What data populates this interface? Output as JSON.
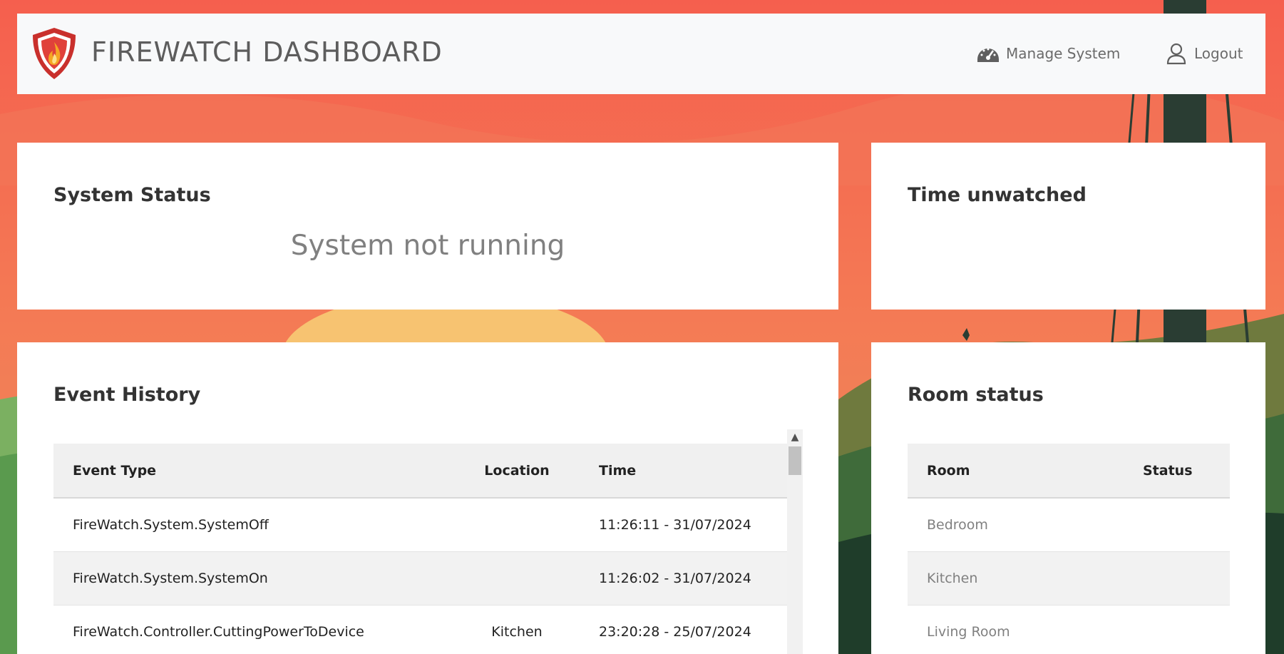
{
  "header": {
    "title": "FIREWATCH DASHBOARD",
    "logo_icon": "firewatch-shield-flame-icon",
    "nav": [
      {
        "label": "Manage System",
        "icon": "speedometer-icon"
      },
      {
        "label": "Logout",
        "icon": "user-icon"
      }
    ]
  },
  "system_status": {
    "title": "System Status",
    "status_text": "System not running"
  },
  "time_unwatched": {
    "title": "Time unwatched"
  },
  "event_history": {
    "title": "Event History",
    "columns": [
      "Event Type",
      "Location",
      "Time"
    ],
    "rows": [
      {
        "event_type": "FireWatch.System.SystemOff",
        "location": "",
        "time": "11:26:11 - 31/07/2024"
      },
      {
        "event_type": "FireWatch.System.SystemOn",
        "location": "",
        "time": "11:26:02 - 31/07/2024"
      },
      {
        "event_type": "FireWatch.Controller.CuttingPowerToDevice",
        "location": "Kitchen",
        "time": "23:20:28 - 25/07/2024"
      }
    ]
  },
  "room_status": {
    "title": "Room status",
    "columns": [
      "Room",
      "Status"
    ],
    "rows": [
      {
        "room": "Bedroom",
        "status": ""
      },
      {
        "room": "Kitchen",
        "status": ""
      },
      {
        "room": "Living Room",
        "status": ""
      }
    ]
  },
  "colors": {
    "background_sky": "#f26b4f",
    "navbar_bg": "#f8f9fa",
    "card_bg": "#ffffff",
    "logo_red": "#c9302c",
    "flame_orange": "#f39c12"
  }
}
